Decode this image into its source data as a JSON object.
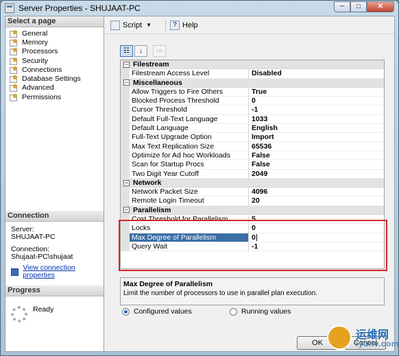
{
  "window": {
    "title": "Server Properties - SHUJAAT-PC",
    "min": "─",
    "max": "□",
    "close": "✕"
  },
  "sidebar": {
    "header": "Select a page",
    "items": [
      {
        "label": "General"
      },
      {
        "label": "Memory"
      },
      {
        "label": "Processors"
      },
      {
        "label": "Security"
      },
      {
        "label": "Connections"
      },
      {
        "label": "Database Settings"
      },
      {
        "label": "Advanced"
      },
      {
        "label": "Permissions"
      }
    ]
  },
  "connection": {
    "header": "Connection",
    "server_label": "Server:",
    "server": "SHUJAAT-PC",
    "connection_label": "Connection:",
    "connection": "Shujaat-PC\\shujaat",
    "view_link": "View connection properties"
  },
  "progress": {
    "header": "Progress",
    "status": "Ready"
  },
  "toolbar": {
    "script": "Script",
    "help": "Help"
  },
  "grid": {
    "categories": [
      {
        "name": "Filestream",
        "props": [
          {
            "name": "Filestream Access Level",
            "value": "Disabled"
          }
        ]
      },
      {
        "name": "Miscellaneous",
        "props": [
          {
            "name": "Allow Triggers to Fire Others",
            "value": "True"
          },
          {
            "name": "Blocked Process Threshold",
            "value": "0"
          },
          {
            "name": "Cursor Threshold",
            "value": "-1"
          },
          {
            "name": "Default Full-Text Language",
            "value": "1033"
          },
          {
            "name": "Default Language",
            "value": "English"
          },
          {
            "name": "Full-Text Upgrade Option",
            "value": "Import"
          },
          {
            "name": "Max Text Replication Size",
            "value": "65536"
          },
          {
            "name": "Optimize for Ad hoc Workloads",
            "value": "False"
          },
          {
            "name": "Scan for Startup Procs",
            "value": "False"
          },
          {
            "name": "Two Digit Year Cutoff",
            "value": "2049"
          }
        ]
      },
      {
        "name": "Network",
        "props": [
          {
            "name": "Network Packet Size",
            "value": "4096"
          },
          {
            "name": "Remote Login Timeout",
            "value": "20"
          }
        ]
      },
      {
        "name": "Parallelism",
        "props": [
          {
            "name": "Cost Threshold for Parallelism",
            "value": "5"
          },
          {
            "name": "Locks",
            "value": "0"
          },
          {
            "name": "Max Degree of Parallelism",
            "value": "0",
            "selected": true
          },
          {
            "name": "Query Wait",
            "value": "-1"
          }
        ]
      }
    ]
  },
  "description": {
    "title": "Max Degree of Parallelism",
    "text": "Limit the number of processors to use in parallel plan execution."
  },
  "options": {
    "configured": "Configured values",
    "running": "Running values",
    "selected": "configured"
  },
  "buttons": {
    "ok": "OK",
    "cancel": "Cancel"
  },
  "watermark": {
    "cn": "运维网",
    "en": "iyunv.com"
  },
  "colors": {
    "highlight": "#d7262b",
    "selection": "#3a6ea5"
  }
}
